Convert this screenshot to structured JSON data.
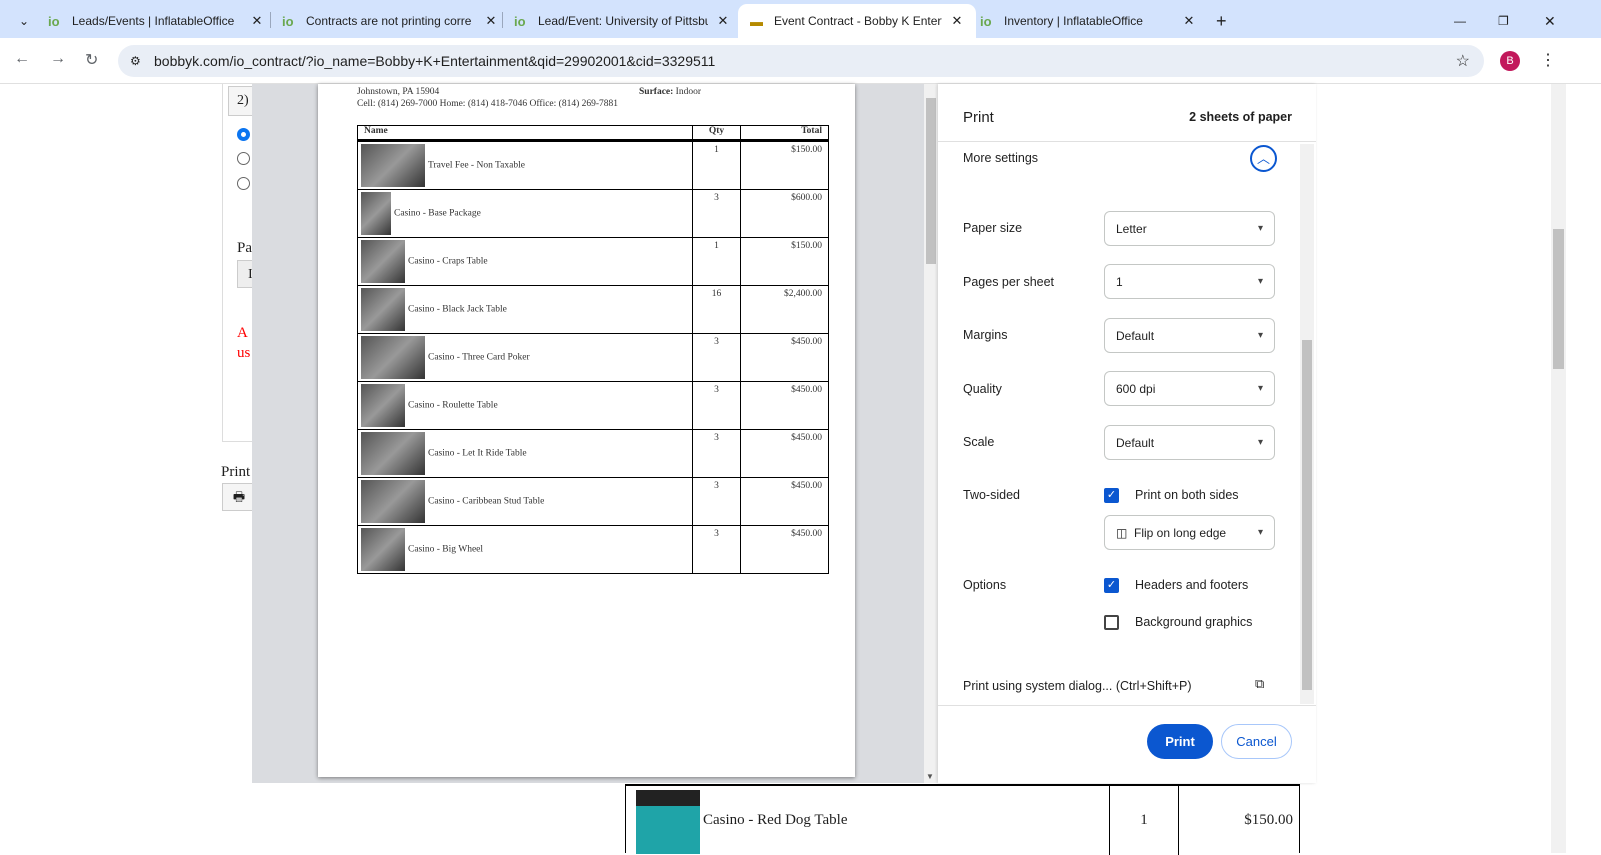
{
  "browser": {
    "tabs": [
      {
        "title": "Leads/Events | InflatableOffice",
        "active": false
      },
      {
        "title": "Contracts are not printing corre",
        "active": false
      },
      {
        "title": "Lead/Event: University of Pittsbu",
        "active": false
      },
      {
        "title": "Event Contract - Bobby K Entert",
        "active": true
      },
      {
        "title": "Inventory | InflatableOffice",
        "active": false
      }
    ],
    "url": "bobbyk.com/io_contract/?io_name=Bobby+K+Entertainment&qid=29902001&cid=3329511",
    "profile_initial": "B"
  },
  "background_page": {
    "step_label": "2)",
    "field_label": "Pa",
    "field_value": "I",
    "warning": "A",
    "warning2": "us",
    "print_label": "Print",
    "row": {
      "name": "Casino - Red Dog Table",
      "qty": "1",
      "total": "$150.00"
    }
  },
  "preview": {
    "address": "Johnstown, PA 15904",
    "phones": "Cell: (814) 269-7000 Home: (814) 418-7046 Office: (814) 269-7881",
    "surface_label": "Surface:",
    "surface_value": "Indoor",
    "headers": {
      "name": "Name",
      "qty": "Qty",
      "total": "Total"
    },
    "items": [
      {
        "name": "Travel Fee - Non Taxable",
        "qty": "1",
        "total": "$150.00"
      },
      {
        "name": "Casino - Base Package",
        "qty": "3",
        "total": "$600.00"
      },
      {
        "name": "Casino - Craps Table",
        "qty": "1",
        "total": "$150.00"
      },
      {
        "name": "Casino - Black Jack Table",
        "qty": "16",
        "total": "$2,400.00"
      },
      {
        "name": "Casino - Three Card Poker",
        "qty": "3",
        "total": "$450.00"
      },
      {
        "name": "Casino - Roulette Table",
        "qty": "3",
        "total": "$450.00"
      },
      {
        "name": "Casino - Let It Ride Table",
        "qty": "3",
        "total": "$450.00"
      },
      {
        "name": "Casino - Caribbean Stud Table",
        "qty": "3",
        "total": "$450.00"
      },
      {
        "name": "Casino - Big Wheel",
        "qty": "3",
        "total": "$450.00"
      }
    ]
  },
  "print": {
    "title": "Print",
    "sheets": "2 sheets of paper",
    "more_settings": "More settings",
    "paper_size_label": "Paper size",
    "paper_size": "Letter",
    "pages_per_sheet_label": "Pages per sheet",
    "pages_per_sheet": "1",
    "margins_label": "Margins",
    "margins": "Default",
    "quality_label": "Quality",
    "quality": "600 dpi",
    "scale_label": "Scale",
    "scale": "Default",
    "two_sided_label": "Two-sided",
    "both_sides": "Print on both sides",
    "both_sides_checked": true,
    "flip": "Flip on long edge",
    "options_label": "Options",
    "headers_footers": "Headers and footers",
    "headers_footers_checked": true,
    "background_graphics": "Background graphics",
    "background_graphics_checked": false,
    "system_dialog": "Print using system dialog... (Ctrl+Shift+P)",
    "print_button": "Print",
    "cancel_button": "Cancel",
    "accent": "#0b57d0"
  }
}
